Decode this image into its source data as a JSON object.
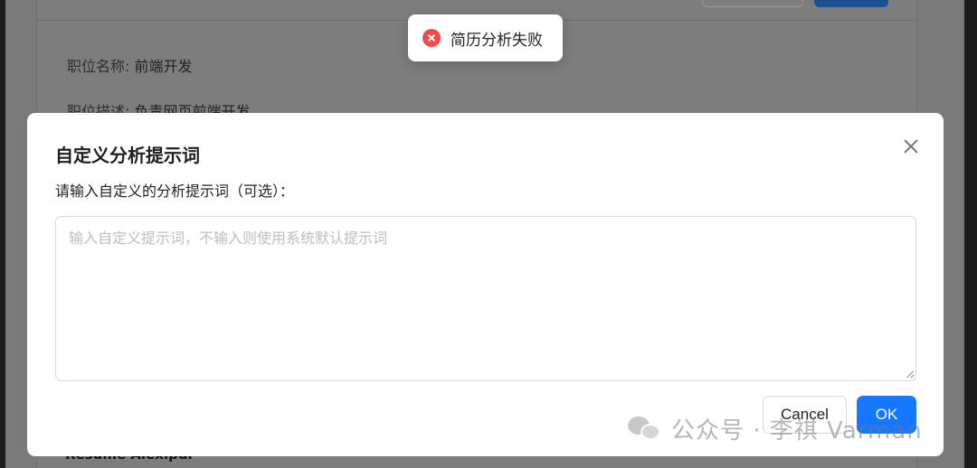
{
  "background": {
    "job_title_label": "职位名称:",
    "job_title_value": "前端开发",
    "job_desc_label": "职位描述:",
    "job_desc_value": "负责网页前端开发",
    "footer_text": "Resume Alexipur"
  },
  "toast": {
    "icon": "error-circle-icon",
    "message": "简历分析失败",
    "color": "#f04a4a"
  },
  "modal": {
    "title": "自定义分析提示词",
    "subtitle": "请输入自定义的分析提示词（可选）：",
    "textarea_value": "",
    "textarea_placeholder": "输入自定义提示词，不输入则使用系统默认提示词",
    "cancel_label": "Cancel",
    "ok_label": "OK",
    "primary_color": "#1677ff"
  },
  "watermark": {
    "icon": "wechat-icon",
    "text": "公众号 · 李祺 Varman"
  }
}
